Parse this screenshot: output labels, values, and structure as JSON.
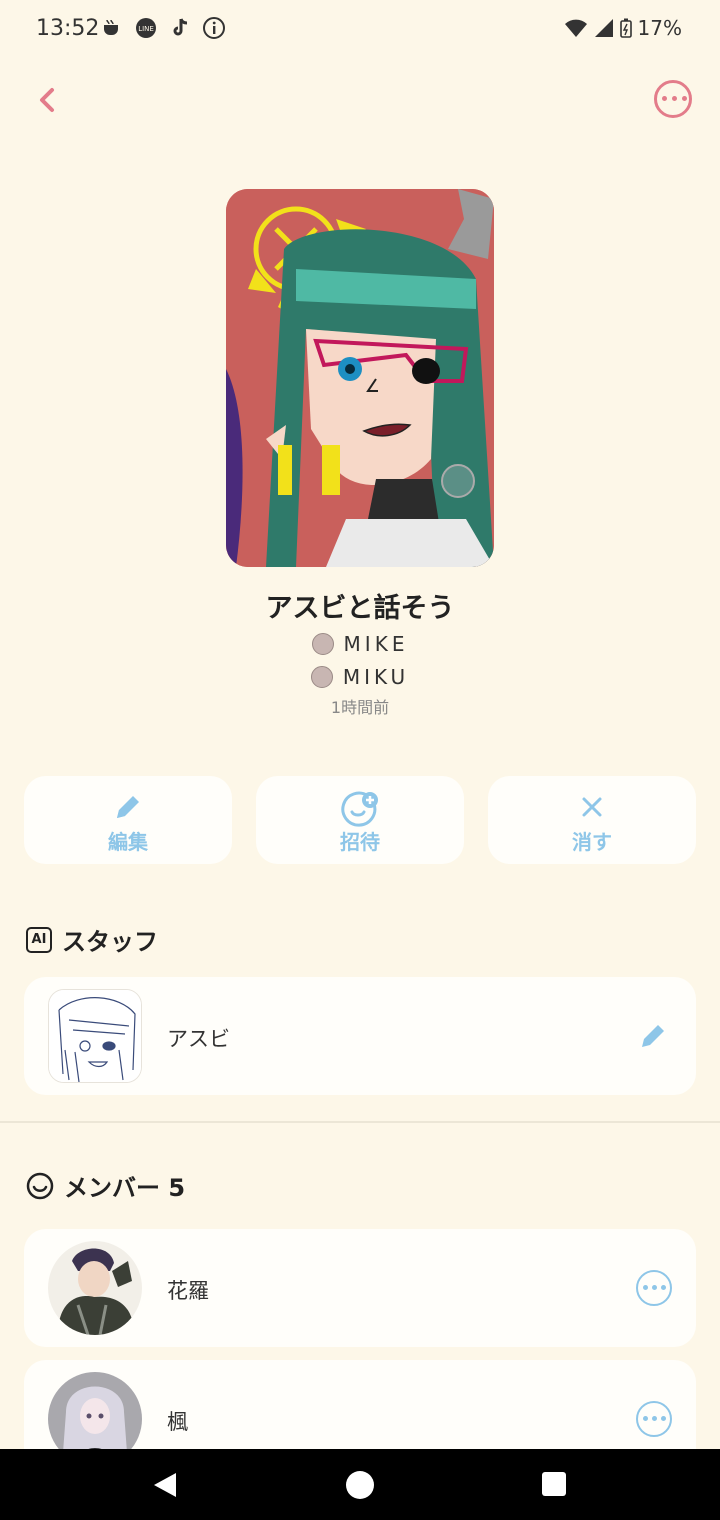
{
  "status_bar": {
    "time": "13:52",
    "battery": "17%",
    "left_icons": [
      "coffee-icon",
      "line-app-icon",
      "tiktok-icon",
      "info-icon"
    ],
    "right_icons": [
      "wifi-icon",
      "signal-icon",
      "battery-icon"
    ]
  },
  "room": {
    "title": "アスビと話そう",
    "participants": [
      {
        "name": "MIKE"
      },
      {
        "name": "MIKU"
      }
    ],
    "time_ago": "1時間前"
  },
  "actions": {
    "edit": "編集",
    "invite": "招待",
    "delete": "消す"
  },
  "staff": {
    "section_title": "スタッフ",
    "badge": "AI",
    "items": [
      {
        "name": "アスビ"
      }
    ]
  },
  "members": {
    "section_title": "メンバー 5",
    "items": [
      {
        "name": "花羅"
      },
      {
        "name": "楓"
      }
    ]
  },
  "colors": {
    "background": "#fdf7e8",
    "accent_pink": "#e37c8a",
    "accent_blue": "#8ec6e8"
  }
}
